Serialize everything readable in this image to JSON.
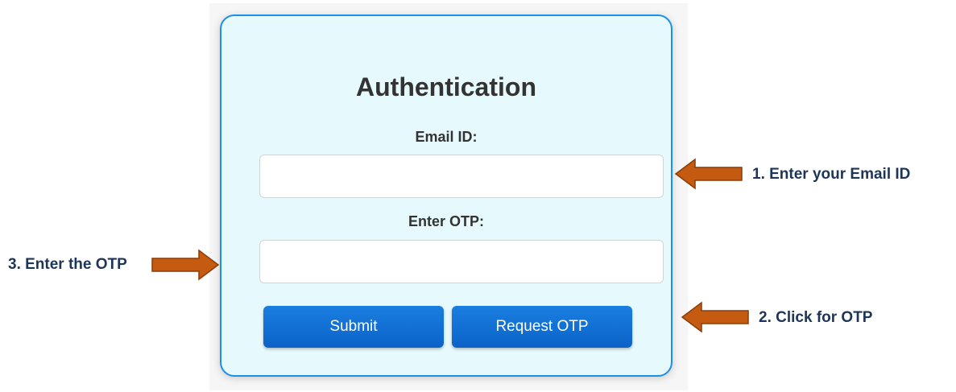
{
  "form": {
    "title": "Authentication",
    "email_label": "Email ID:",
    "email_value": "",
    "otp_label": "Enter OTP:",
    "otp_value": "",
    "submit_label": "Submit",
    "request_otp_label": "Request OTP"
  },
  "annotations": {
    "step1": "1. Enter your Email ID",
    "step2": "2. Click for OTP",
    "step3": "3. Enter the OTP"
  },
  "colors": {
    "card_bg": "#e6f9fd",
    "card_border": "#1e8fe8",
    "button": "#0b62c8",
    "arrow_fill": "#c55a11",
    "annotation_text": "#1d3557"
  },
  "icons": {
    "step1_arrow": "arrow-left-icon",
    "step2_arrow": "arrow-left-icon",
    "step3_arrow": "arrow-right-icon"
  }
}
